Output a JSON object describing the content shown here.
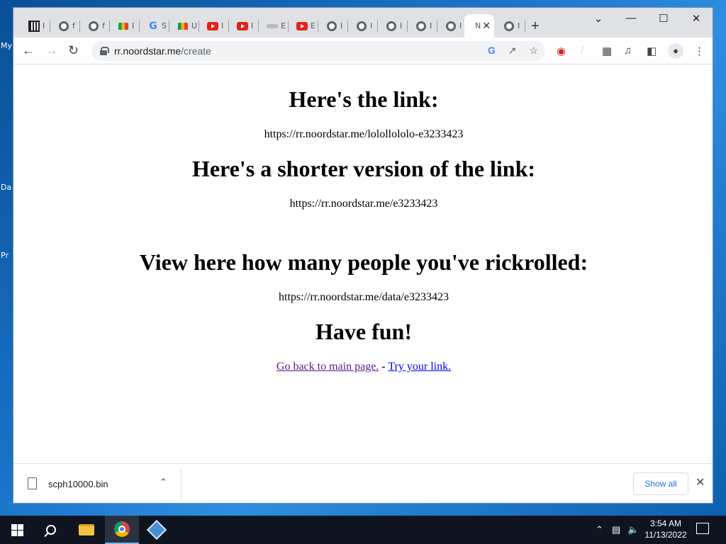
{
  "desktop": {
    "icon_labels": [
      "My",
      "Da",
      "Pr"
    ]
  },
  "browser": {
    "tabs": [
      {
        "icon": "bank-icon",
        "title": "I"
      },
      {
        "icon": "chrome-icon",
        "title": "f"
      },
      {
        "icon": "chrome-icon",
        "title": "f"
      },
      {
        "icon": "drive-icon",
        "title": "I"
      },
      {
        "icon": "google-icon",
        "title": "S"
      },
      {
        "icon": "drive-icon",
        "title": "U"
      },
      {
        "icon": "youtube-icon",
        "title": "I"
      },
      {
        "icon": "youtube-icon",
        "title": "I"
      },
      {
        "icon": "gray-icon",
        "title": "E"
      },
      {
        "icon": "youtube-icon",
        "title": "E"
      },
      {
        "icon": "chrome-icon",
        "title": "I"
      },
      {
        "icon": "chrome-icon",
        "title": "I"
      },
      {
        "icon": "chrome-icon",
        "title": "I"
      },
      {
        "icon": "chrome-icon",
        "title": "I"
      },
      {
        "icon": "chrome-icon",
        "title": "I"
      },
      {
        "icon": "none",
        "title": "N",
        "active": true
      },
      {
        "icon": "chrome-icon",
        "title": "I"
      }
    ],
    "url_host": "rr.noordstar.me",
    "url_path": "/create"
  },
  "page": {
    "heading_link": "Here's the link:",
    "link_full": "https://rr.noordstar.me/lolollololo-e3233423",
    "heading_short": "Here's a shorter version of the link:",
    "link_short": "https://rr.noordstar.me/e3233423",
    "heading_data": "View here how many people you've rickrolled:",
    "link_data": "https://rr.noordstar.me/data/e3233423",
    "heading_fun": "Have fun!",
    "back_link": "Go back to main page.",
    "separator": " - ",
    "try_link": "Try your link."
  },
  "downloads": {
    "file_name": "scph10000.bin",
    "show_all": "Show all"
  },
  "taskbar": {
    "time": "3:54 AM",
    "date": "11/13/2022"
  }
}
